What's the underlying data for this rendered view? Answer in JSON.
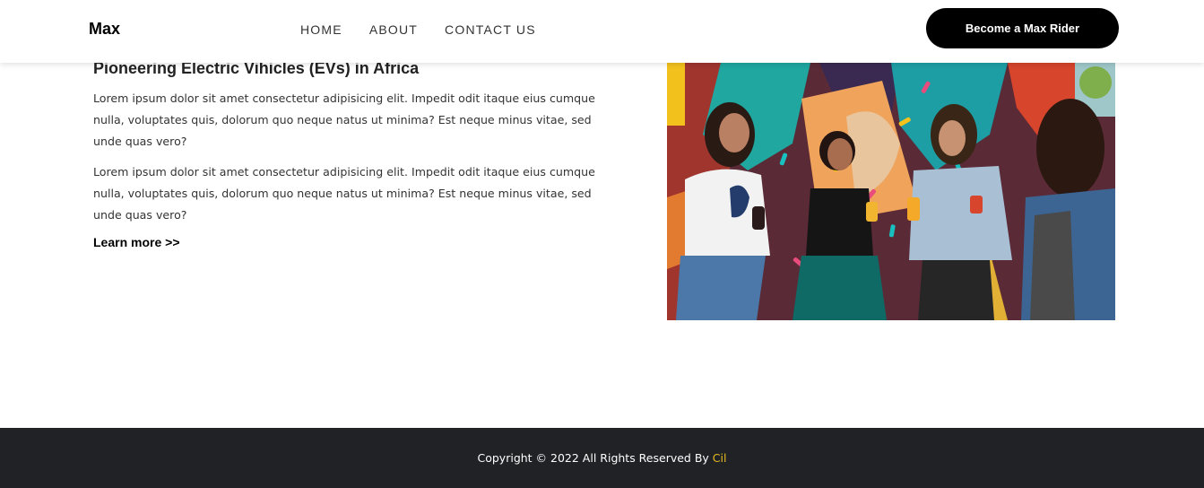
{
  "navbar": {
    "brand": "Max",
    "links": [
      {
        "label": "HOME"
      },
      {
        "label": "ABOUT"
      },
      {
        "label": "CONTACT US"
      }
    ],
    "cta_label": "Become a Max Rider"
  },
  "content": {
    "headline": "Pioneering Electric Vihicles (EVs) in Africa",
    "paragraphs": [
      "Lorem ipsum dolor sit amet consectetur adipisicing elit. Impedit odit itaque eius cumque nulla, voluptates quis, dolorum quo neque natus ut minima? Est neque minus vitae, sed unde quas vero?",
      "Lorem ipsum dolor sit amet consectetur adipisicing elit. Impedit odit itaque eius cumque nulla, voluptates quis, dolorum quo neque natus ut minima? Est neque minus vitae, sed unde quas vero?"
    ],
    "learn_more": "Learn more >>"
  },
  "footer": {
    "copyright": "Copyright © 2022 All Rights Reserved By",
    "link": "Cil",
    "link_color": "#e7b91f"
  }
}
